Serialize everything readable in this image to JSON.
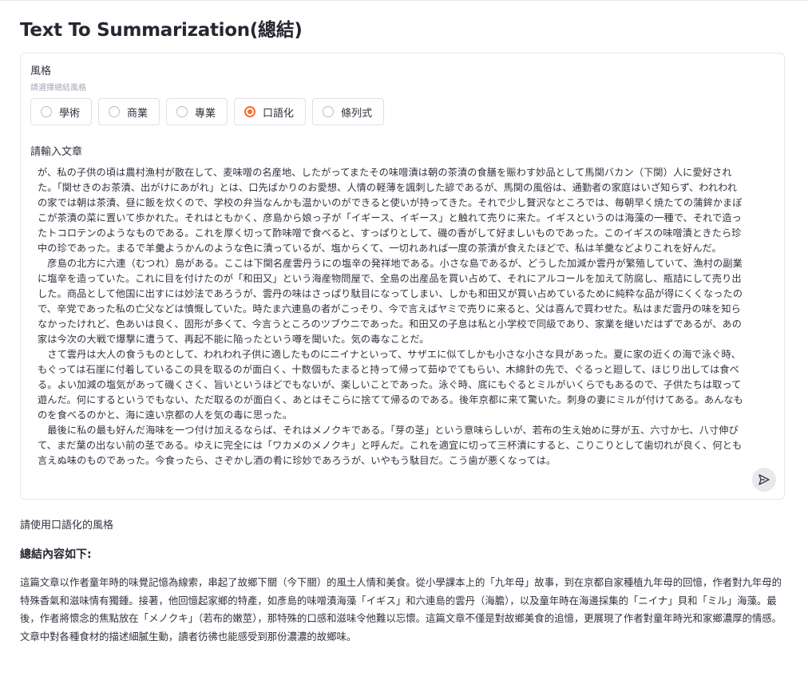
{
  "page": {
    "title": "Text To Summarization(總結)"
  },
  "style_section": {
    "label": "風格",
    "hint": "請選擇總結風格",
    "options": [
      "學術",
      "商業",
      "專業",
      "口語化",
      "條列式"
    ],
    "selected": "口語化",
    "accent_color": "#ff6b2c"
  },
  "input": {
    "label": "請輸入文章",
    "text": "が、私の子供の頃は農村漁村が散在して、麦味噌の名産地、したがってまたその味噌漬は朝の茶漬の食膳を賑わす妙品として馬関バカン（下関）人に愛好された。「関せきのお茶漬、出がけにあがれ」とは、口先ばかりのお愛想、人情の軽薄を諷刺した諺であるが、馬関の風俗は、通勤者の家庭はいざ知らず、われわれの家では朝は茶漬、昼に飯を炊くので、学校の弁当なんかも温かいのができると使いが持ってきた。それで少し贅沢なところでは、毎朝早く焼たての蒲鉾かまぼこが茶漬の菜に置いて歩かれた。それはともかく、彦島から娘っ子が「イギース、イギース」と触れて売りに来た。イギスというのは海藻の一種で、それで造ったトコロテンのようなものである。これを厚く切って酢味噌で食べると、すっぱりとして、磯の香がして好ましいものであった。このイギスの味噌漬ときたら珍中の珍であった。まるで羊羹ようかんのような色に漬っているが、塩からくて、一切れあれば一度の茶漬が食えたほどで、私は羊羹などよりこれを好んだ。\n　彦島の北方に六連（むつれ）島がある。ここは下関名産雲丹うにの塩辛の発祥地である。小さな島であるが、どうした加減か雲丹が繁殖していて、漁村の副業に塩辛を造っていた。これに目を付けたのが「和田又」という海産物問屋で、全島の出産品を買い占めて、それにアルコールを加えて防腐し、瓶詰にして売り出した。商品として他国に出すには妙法であろうが、雲丹の味はさっぱり駄目になってしまい、しかも和田又が買い占めているために純粋な品が得にくくなったので、辛党であった私の亡父などは憤慨していた。時たま六連島の者がこっそり、今で言えばヤミで売りに来ると、父は喜んで買わせた。私はまだ雲丹の味を知らなかったけれど、色あいは良く、固形が多くて、今言うところのツブウニであった。和田又の子息は私と小学校で同級であり、家業を継いだはずであるが、あの家は今次の大戦で爆撃に遭うて、再起不能に陥ったという噂を聞いた。気の毒なことだ。\n　さて雲丹は大人の食うものとして、われわれ子供に適したものにニイナといって、サザエに似てしかも小さな小さな貝があった。夏に家の近くの海で泳ぐ時、もぐっては石崖に付着しているこの貝を取るのが面白く、十数個もたまると持って帰って茹ゆでてもらい、木綿針の先で、ぐるっと廻して、ほじり出しては食べる。よい加減の塩気があって磯くさく、旨いというほどでもないが、楽しいことであった。泳ぐ時、底にもぐるとミルがいくらでもあるので、子供たちは取って遊んだ。何にするというでもない、ただ取るのが面白く、あとはそこらに捨てて帰るのである。後年京都に来て驚いた。刺身の妻にミルが付けてある。あんなものを食べるのかと、海に遠い京都の人を気の毒に思った。\n　最後に私の最も好んだ海味を一つ付け加えるならば、それはメノクキである。「芽の茎」という意味らしいが、若布の生え始めに芽が五、六寸か七、八寸伸びて、まだ葉の出ない前の茎である。ゆえに完全には「ワカメのメノクキ」と呼んだ。これを適宜に切って三杯漬にすると、こりこりとして歯切れが良く、何とも言えぬ味のものであった。今食ったら、さぞかし酒の肴に珍妙であろうが、いやもう駄目だ。こう歯が悪くなっては。"
  },
  "send_icon": "send-icon",
  "prompt_echo": "請使用口語化的風格",
  "summary": {
    "heading": "總結內容如下:",
    "text": "這篇文章以作者童年時的味覺記憶為線索，串起了故鄉下關（今下關）的風土人情和美食。從小學課本上的「九年母」故事，到在京都自家種植九年母的回憶，作者對九年母的特殊香氣和滋味情有獨鍾。接著，他回憶起家鄉的特產，如彥島的味噌漬海藻「イギス」和六連島的雲丹（海膽），以及童年時在海邊採集的「ニイナ」貝和「ミル」海藻。最後，作者將懷念的焦點放在「メノクキ」（若布的嫩莖），那特殊的口感和滋味令他難以忘懷。這篇文章不僅是對故鄉美食的追憶，更展現了作者對童年時光和家鄉濃厚的情感。文章中對各種食材的描述細膩生動，讀者彷彿也能感受到那份濃濃的故鄉味。"
  }
}
